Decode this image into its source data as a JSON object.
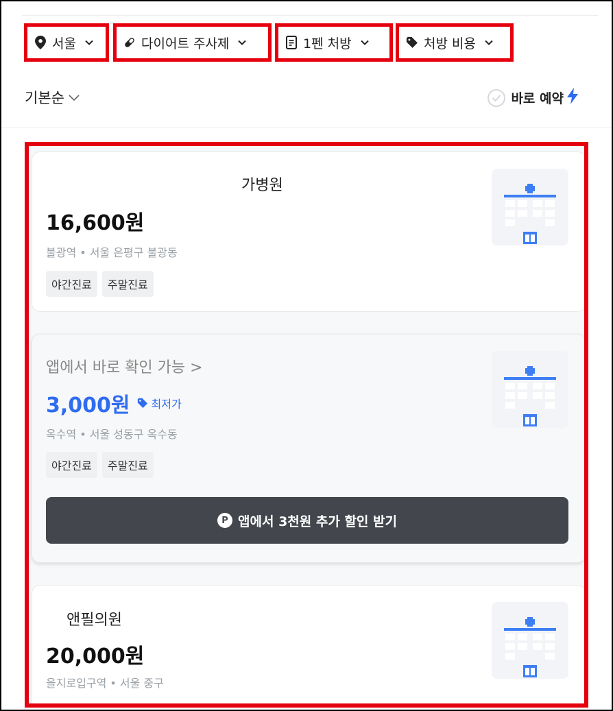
{
  "filters": [
    {
      "label": "서울",
      "icon": "location-pin-icon"
    },
    {
      "label": "다이어트 주사제",
      "icon": "pill-icon"
    },
    {
      "label": "1펜 처방",
      "icon": "document-icon"
    },
    {
      "label": "처방 비용",
      "icon": "price-tag-icon"
    }
  ],
  "sort": {
    "label": "기본순"
  },
  "instant_booking": {
    "label": "바로 예약"
  },
  "clinics": [
    {
      "name": "가병원",
      "price": "16,600원",
      "location": "불광역 • 서울 은평구 불광동",
      "tags": [
        "야간진료",
        "주말진료"
      ]
    },
    {
      "app_line": "앱에서 바로 확인 가능 >",
      "price": "3,000원",
      "badge": "최저가",
      "location": "옥수역 • 서울 성동구 옥수동",
      "tags": [
        "야간진료",
        "주말진료"
      ],
      "cta": "앱에서 3천원 추가 할인 받기",
      "cta_icon": "P"
    },
    {
      "name": "앤필의원",
      "price": "20,000원",
      "location": "을지로입구역 • 서울 중구"
    }
  ],
  "colors": {
    "accent_blue": "#2e6cf0",
    "highlight_red": "#e5000e",
    "cta_dark": "#43464d"
  }
}
